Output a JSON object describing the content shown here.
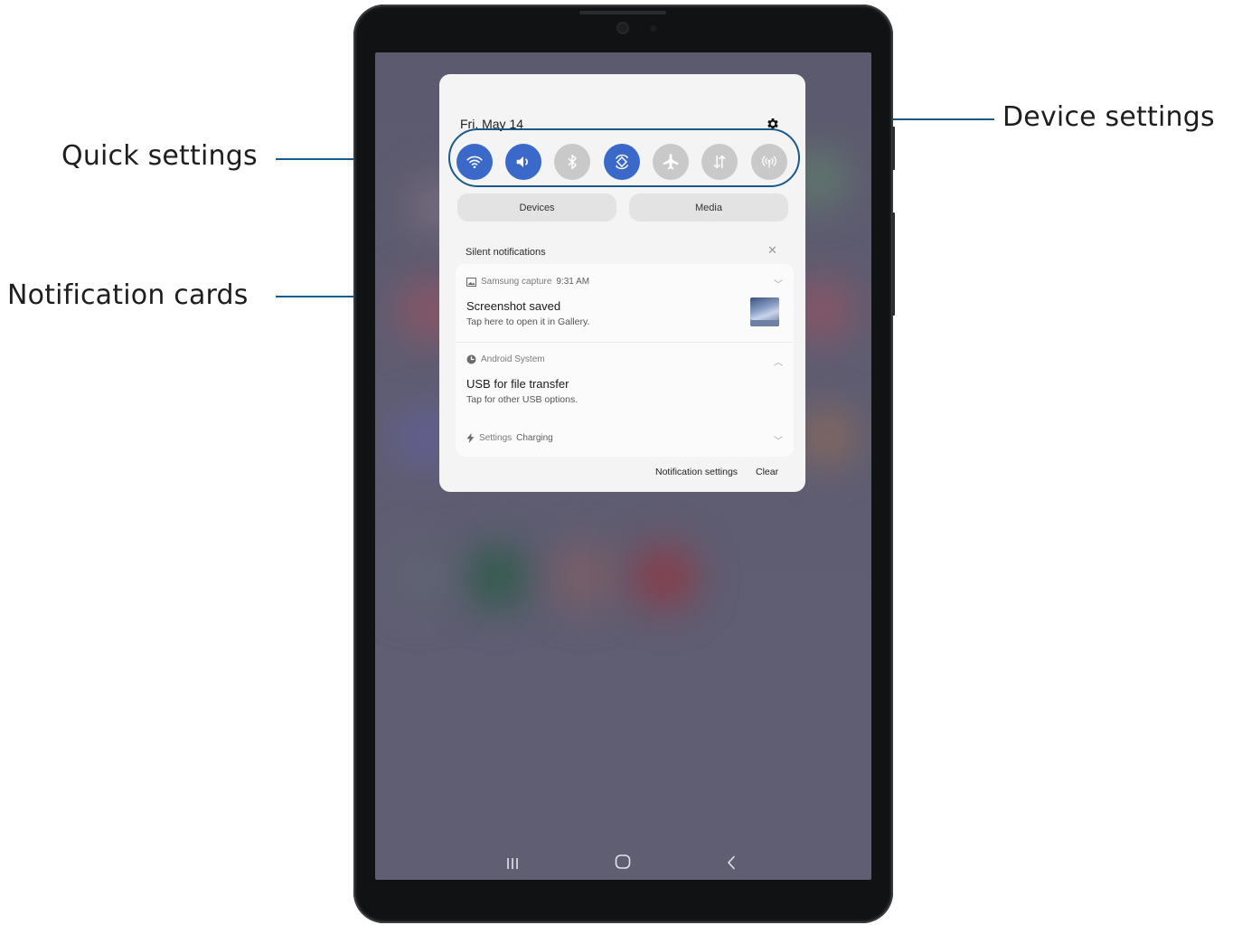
{
  "callouts": {
    "quick_settings": "Quick settings",
    "notification_cards": "Notification cards",
    "device_settings": "Device settings"
  },
  "panel": {
    "date": "Fri, May 14",
    "quick_settings": [
      {
        "name": "wifi-icon",
        "state": "on"
      },
      {
        "name": "sound-icon",
        "state": "on"
      },
      {
        "name": "bluetooth-icon",
        "state": "off"
      },
      {
        "name": "auto-rotate-icon",
        "state": "on"
      },
      {
        "name": "airplane-mode-icon",
        "state": "off"
      },
      {
        "name": "mobile-data-icon",
        "state": "off"
      },
      {
        "name": "hotspot-icon",
        "state": "off"
      }
    ],
    "devices_label": "Devices",
    "media_label": "Media",
    "silent_title": "Silent notifications",
    "notifications": [
      {
        "app": "Samsung capture",
        "time": "9:31 AM",
        "title": "Screenshot saved",
        "text": "Tap here to open it in Gallery."
      },
      {
        "app": "Android System",
        "title": "USB for file transfer",
        "text": "Tap for other USB options."
      },
      {
        "app": "Settings",
        "text": "Charging"
      }
    ],
    "notification_settings_label": "Notification settings",
    "clear_label": "Clear"
  },
  "colors": {
    "accent": "#3a69c9",
    "callout_line": "#1a5a8a"
  }
}
